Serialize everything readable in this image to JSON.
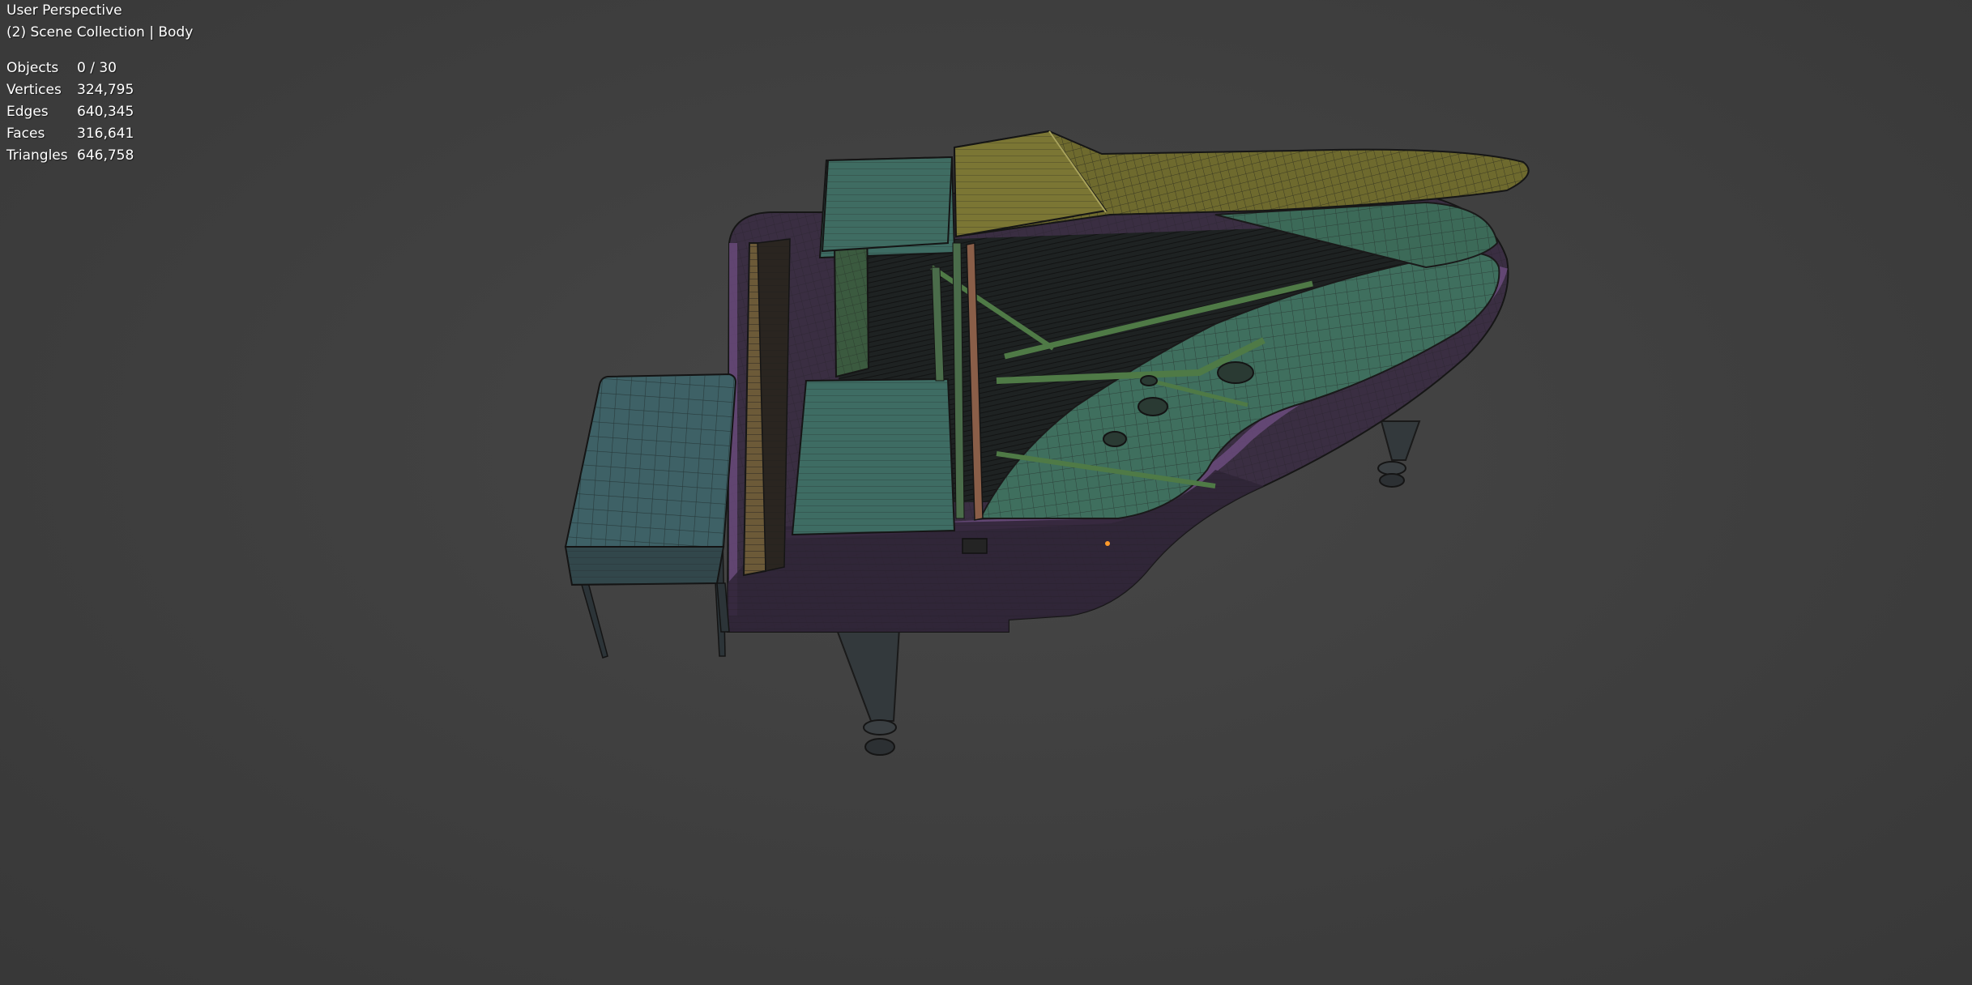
{
  "viewport": {
    "view_name": "User Perspective",
    "collection_info": "(2) Scene Collection | Body",
    "stats": [
      {
        "label": "Objects",
        "value": "0 / 30"
      },
      {
        "label": "Vertices",
        "value": "324,795"
      },
      {
        "label": "Edges",
        "value": "640,345"
      },
      {
        "label": "Faces",
        "value": "316,641"
      },
      {
        "label": "Triangles",
        "value": "646,758"
      }
    ]
  },
  "colors": {
    "background": "#3d3d3d",
    "case": "#3a2e42",
    "case_edge": "#5a3f6a",
    "lid": "#6e6a2e",
    "soundboard": "#3f6f5e",
    "bench": "#3e6166",
    "wire": "#1c1c1c"
  }
}
